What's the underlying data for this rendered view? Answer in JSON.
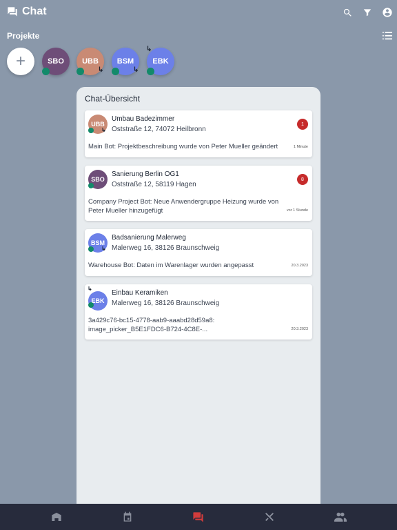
{
  "header": {
    "title": "Chat",
    "icons": [
      "search-icon",
      "filter-icon",
      "account-icon"
    ]
  },
  "projects": {
    "label": "Projekte",
    "add_label": "+",
    "items": [
      {
        "initials": "SBO",
        "color": "#6e4d78",
        "online": true
      },
      {
        "initials": "UBB",
        "color": "#c98a74",
        "online": true,
        "arrow": "↳"
      },
      {
        "initials": "BSM",
        "color": "#6c80e8",
        "online": true,
        "arrow": "↳"
      },
      {
        "initials": "EBK",
        "color": "#6c80e8",
        "online": true,
        "arrow": "↳"
      }
    ]
  },
  "panel": {
    "title": "Chat-Übersicht",
    "chats": [
      {
        "initials": "UBB",
        "title": "Umbau Badezimmer",
        "address": "Oststraße 12, 74072  Heilbronn",
        "message": "Main Bot: Projektbeschreibung wurde von Peter Mueller geändert",
        "time": "1 Minute",
        "unread": "1"
      },
      {
        "initials": "SBO",
        "title": "Sanierung Berlin OG1",
        "address": "Oststraße 12, 58119  Hagen",
        "message": "Company Project Bot: Neue Anwendergruppe Heizung wurde von Peter Mueller hinzugefügt",
        "time": "vor 1 Stunde",
        "unread": "8"
      },
      {
        "initials": "BSM",
        "title": "Badsanierung Malerweg",
        "address": "Malerweg 16, 38126  Braunschweig",
        "message": "Warehouse Bot: Daten im Warenlager wurden angepasst",
        "time": "20.3.2023"
      },
      {
        "initials": "EBK",
        "title": "Einbau Keramiken",
        "address": "Malerweg 16, 38126  Braunschweig",
        "message": "3a429c76-bc15-4778-aab9-aaabd28d59a8: image_picker_B5E1FDC6-B724-4C8E-...",
        "time": "20.3.2023"
      }
    ]
  },
  "nav": {
    "items": [
      "home-icon",
      "calendar-icon",
      "chat-icon",
      "tools-icon",
      "people-icon"
    ],
    "active": "chat-icon",
    "active_color": "#d33c3c"
  }
}
